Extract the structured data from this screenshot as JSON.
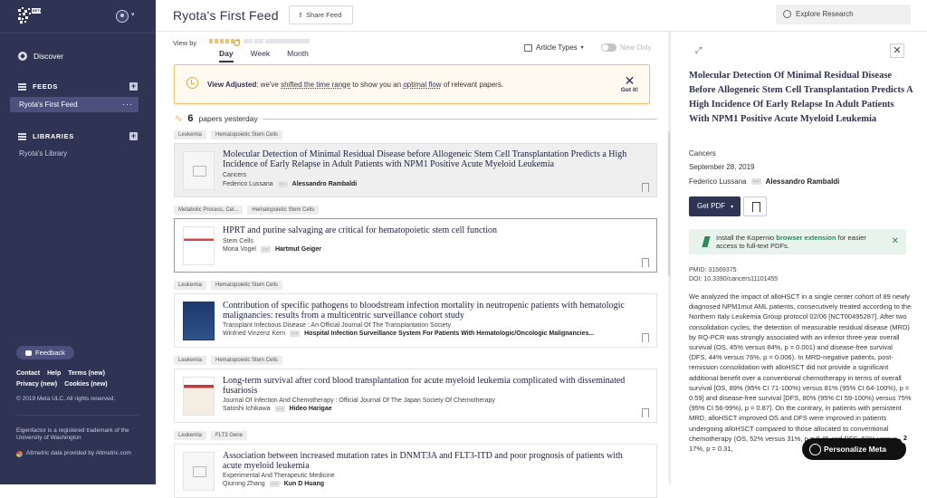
{
  "sidebar": {
    "logo_sub": "BETA",
    "discover": "Discover",
    "feeds_header": "FEEDS",
    "feed_item": "Ryota's First Feed",
    "feed_more": "···",
    "libraries_header": "LIBRARIES",
    "library_item": "Ryota's Library",
    "feedback": "Feedback",
    "links_row1": [
      "Contact",
      "Help",
      "Terms (new)"
    ],
    "links_row2": [
      "Privacy (new)",
      "Cookies (new)"
    ],
    "copyright": "© 2019 Meta ULC. All rights reserved.",
    "trademark": "Eigenfactor is a registered trademark of the University of Washington",
    "altmetric": "Altmetric data provided by Altmetric.com"
  },
  "header": {
    "title": "Ryota's First Feed",
    "share": "Share Feed",
    "search_placeholder": "Explore Research"
  },
  "controls": {
    "view_by": "View by",
    "tabs": [
      "Day",
      "Week",
      "Month"
    ],
    "article_types": "Article Types",
    "new_only": "New Only"
  },
  "alert": {
    "bold": "View Adjusted",
    "text1": ": we've ",
    "link1": "shifted the time range",
    "text2": " to show you an ",
    "link2": "optimal flow",
    "text3": " of relevant papers.",
    "dismiss": "Got it!"
  },
  "count": {
    "number": "6",
    "label": "papers yesterday"
  },
  "papers": [
    {
      "tags": [
        "Leukemia",
        "Hematopoietic Stem Cells"
      ],
      "title": "Molecular Detection of Minimal Residual Disease before Allogeneic Stem Cell Transplantation Predicts a High Incidence of Early Relapse in Adult Patients with NPM1 Positive Acute Myeloid Leukemia",
      "journal": "Cancers",
      "author_first": "Federico Lussana",
      "author_last": "Alessandro Rambaldi"
    },
    {
      "tags": [
        "Metabolic Process, Cel...",
        "Hematopoietic Stem Cells"
      ],
      "title": "HPRT and purine salvaging are critical for hematopoietic stem cell function",
      "journal": "Stem Cells",
      "author_first": "Mona Vogel",
      "author_last": "Hartmut Geiger"
    },
    {
      "tags": [
        "Leukemia",
        "Hematopoietic Stem Cells"
      ],
      "title": "Contribution of specific pathogens to bloodstream infection mortality in neutropenic patients with hematologic malignancies: results from a multicentric surveillance cohort study",
      "journal": "Transplant Infectious Disease : An Official Journal Of The Transplantation Society",
      "author_first": "Winfried Vinzenz Kern",
      "author_last": "Hospital Infection Surveillance System For Patients With Hematologic/Oncologic Malignancies..."
    },
    {
      "tags": [
        "Leukemia",
        "Hematopoietic Stem Cells"
      ],
      "title": "Long-term survival after cord blood transplantation for acute myeloid leukemia complicated with disseminated fusariosis",
      "journal": "Journal Of Infection And Chemotherapy : Official Journal Of The Japan Society Of Chemotherapy",
      "author_first": "Satoshi Ichikawa",
      "author_last": "Hideo Harigae"
    },
    {
      "tags": [
        "Leukemia",
        "FLT3 Gene"
      ],
      "title": "Association between increased mutation rates in DNMT3A and FLT3-ITD and poor prognosis of patients with acute myeloid leukemia",
      "journal": "Experimental And Therapeutic Medicine",
      "author_first": "Qiurong Zhang",
      "author_last": "Kun D Huang"
    }
  ],
  "detail": {
    "title": "Molecular Detection Of Minimal Residual Disease Before Allogeneic Stem Cell Transplantation Predicts A High Incidence Of Early Relapse In Adult Patients With NPM1 Positive Acute Myeloid Leukemia",
    "journal": "Cancers",
    "date": "September 28, 2019",
    "author_first": "Federico Lussana",
    "author_last": "Alessandro Rambaldi",
    "get_pdf": "Get PDF",
    "ext_text1": "Install the Kopernio ",
    "ext_link": "browser extension",
    "ext_text2": " for easier access to full-text PDFs.",
    "pmid": "PMID: 31569375",
    "doi": "DOI: 10.3390/cancers11101455",
    "abstract": "We analyzed the impact of alloHSCT in a single center cohort of 89 newly diagnosed NPM1mut AML patients, consecutively treated according to the Northern Italy Leukemia Group protocol 02/06 [NCT00495287]. After two consolidation cycles, the detection of measurable residual disease (MRD) by RQ-PCR was strongly associated with an inferior three-year overall survival (OS, 45% versus 84%, p = 0.001) and disease-free survival (DFS, 44% versus 76%, p = 0.006). In MRD-negative patients, post-remission consolidation with alloHSCT did not provide a significant additional benefit over a conventional chemotherapy in terms of overall survival [OS, 89% (95% CI 71-100%) versus 81% (95% CI 64-100%), p = 0.59] and disease-free survival [DFS, 80% (95% CI 59-100%) versus 75% (95% CI 56-99%), p = 0.87]. On the contrary, in patients with persistent MRD, alloHSCT improved OS and DFS were improved in patients undergoing alloHSCT compared to those allocated to conventional chemotherapy (OS, 52% versus 31%, p = 0.45 and DFS, 50% versus 17%, p = 0.31,"
  },
  "personalize": {
    "label": "Personalize Meta",
    "badge": "2"
  }
}
